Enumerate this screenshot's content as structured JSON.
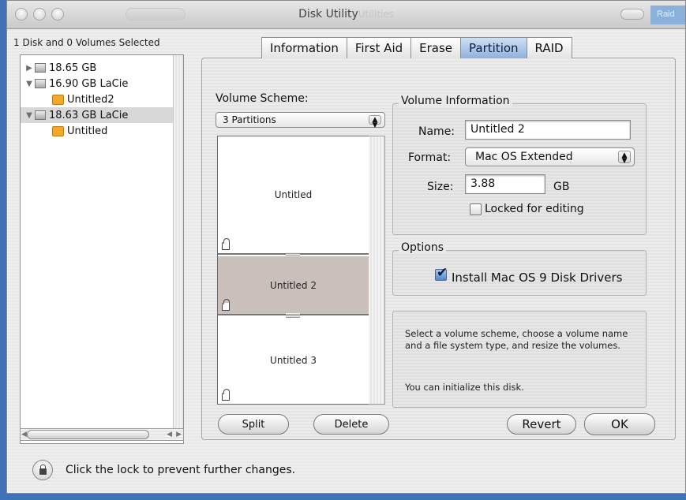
{
  "window": {
    "title": "Disk Utility",
    "ghost_title": "Utilities",
    "ghost_button": "Raid"
  },
  "sidebar": {
    "summary": "1 Disk and 0 Volumes Selected",
    "items": [
      {
        "label": "18.65 GB",
        "type": "disk",
        "expanded": false
      },
      {
        "label": "16.90 GB LaCie",
        "type": "disk",
        "expanded": true
      },
      {
        "label": "Untitled2",
        "type": "volume"
      },
      {
        "label": "18.63 GB LaCie",
        "type": "disk",
        "expanded": true,
        "selected": true
      },
      {
        "label": "Untitled",
        "type": "volume"
      }
    ]
  },
  "tabs": [
    {
      "label": "Information",
      "active": false
    },
    {
      "label": "First Aid",
      "active": false
    },
    {
      "label": "Erase",
      "active": false
    },
    {
      "label": "Partition",
      "active": true
    },
    {
      "label": "RAID",
      "active": false
    }
  ],
  "partition": {
    "volume_scheme_label": "Volume Scheme:",
    "volume_scheme_value": "3 Partitions",
    "partitions": [
      {
        "name": "Untitled",
        "selected": false
      },
      {
        "name": "Untitled 2",
        "selected": true
      },
      {
        "name": "Untitled 3",
        "selected": false
      }
    ],
    "split_label": "Split",
    "delete_label": "Delete"
  },
  "volume_info": {
    "title": "Volume Information",
    "name_label": "Name:",
    "name_value": "Untitled 2",
    "format_label": "Format:",
    "format_value": "Mac OS Extended",
    "size_label": "Size:",
    "size_value": "3.88",
    "size_unit": "GB",
    "locked_label": "Locked for editing",
    "locked": false
  },
  "options": {
    "title": "Options",
    "install_drivers_label": "Install Mac OS 9 Disk Drivers",
    "install_drivers": true
  },
  "help": {
    "line1": "Select a volume scheme, choose a volume name and a file system type, and resize the volumes.",
    "line2": "You can initialize this disk."
  },
  "buttons": {
    "revert": "Revert",
    "ok": "OK"
  },
  "footer": {
    "lock_message": "Click the lock to prevent further changes."
  },
  "colors": {
    "desktop": "#3f73b6",
    "active_tab": "#8fb1dc",
    "selected_partition": "#c9c0bc"
  }
}
